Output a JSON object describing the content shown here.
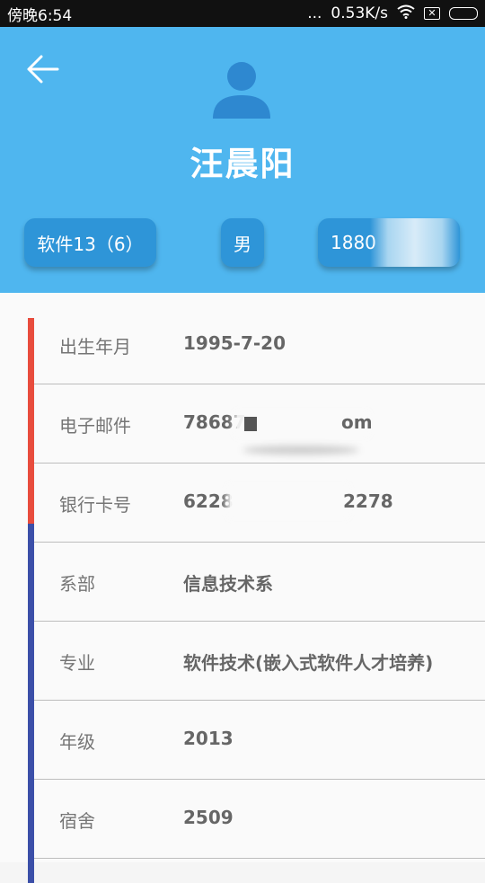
{
  "status_bar": {
    "time": "傍晚6:54",
    "signal_dots": "...",
    "network_speed": "0.53K/s",
    "icons": [
      "wifi-icon",
      "sim-x-icon",
      "battery-icon"
    ]
  },
  "header": {
    "name": "汪晨阳",
    "class_chip": "软件13（6）",
    "gender_chip": "男",
    "phone_chip": "1880",
    "icons": [
      "back-arrow-icon",
      "avatar-person-icon"
    ]
  },
  "info": {
    "rows": [
      {
        "label": "出生年月",
        "value": "1995-7-20"
      },
      {
        "label": "电子邮件",
        "value": "78687",
        "value_tail": "om"
      },
      {
        "label": "银行卡号",
        "value": "6228",
        "value_tail": "2278"
      },
      {
        "label": "系部",
        "value": "信息技术系"
      },
      {
        "label": "专业",
        "value": "软件技术(嵌入式软件人才培养)"
      },
      {
        "label": "年级",
        "value": "2013"
      },
      {
        "label": "宿舍",
        "value": "2509"
      }
    ]
  },
  "colors": {
    "header_bg": "#4fb6ef",
    "chip_bg": "#2e95d8",
    "accent_red": "#e84c3d",
    "accent_blue": "#3b4fa8"
  }
}
